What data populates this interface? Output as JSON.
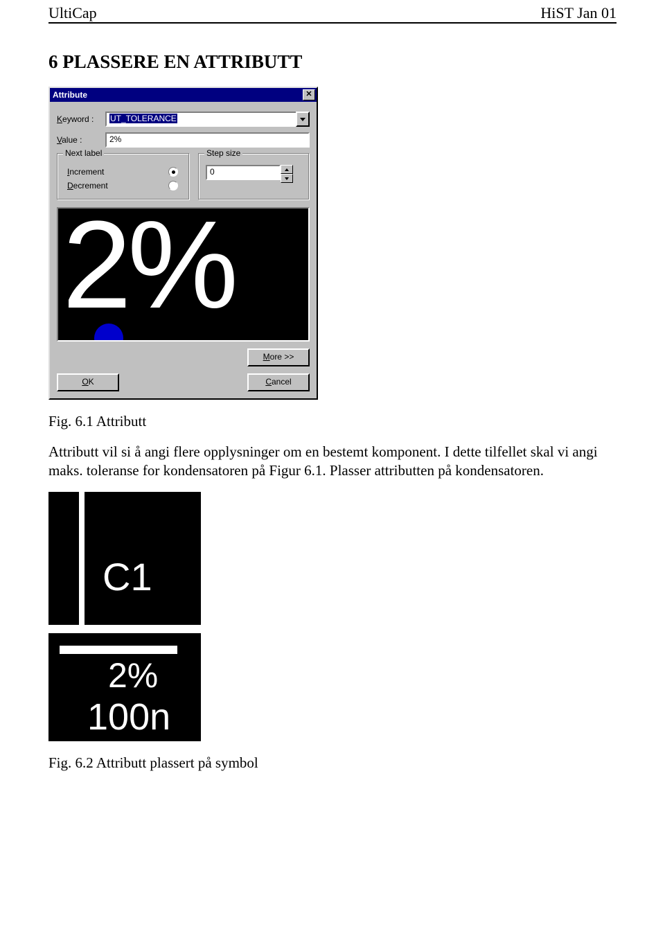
{
  "header": {
    "left": "UltiCap",
    "right": "HiST Jan 01"
  },
  "section_title": "6 PLASSERE EN ATTRIBUTT",
  "dialog": {
    "title": "Attribute",
    "keyword_label": "Keyword :",
    "keyword_value": "UT_TOLERANCE",
    "value_label": "Value :",
    "value_value": "2%",
    "next_label_legend": "Next label",
    "increment_label": "Increment",
    "decrement_label": "Decrement",
    "next_label_choice": "increment",
    "step_legend": "Step size",
    "step_value": "0",
    "preview_text": "2%",
    "more_btn": "More >>",
    "ok_btn": "OK",
    "cancel_btn": "Cancel"
  },
  "caption1": "Fig. 6.1 Attributt",
  "paragraph": "Attributt vil si å angi flere opplysninger om en bestemt komponent. I dette tilfellet skal vi angi maks. toleranse for kondensatoren på Figur 6.1.  Plasser attributten på kondensatoren.",
  "symbol": {
    "ref": "C1",
    "tolerance": "2%",
    "value": "100n"
  },
  "caption2": "Fig. 6.2 Attributt plassert på symbol"
}
